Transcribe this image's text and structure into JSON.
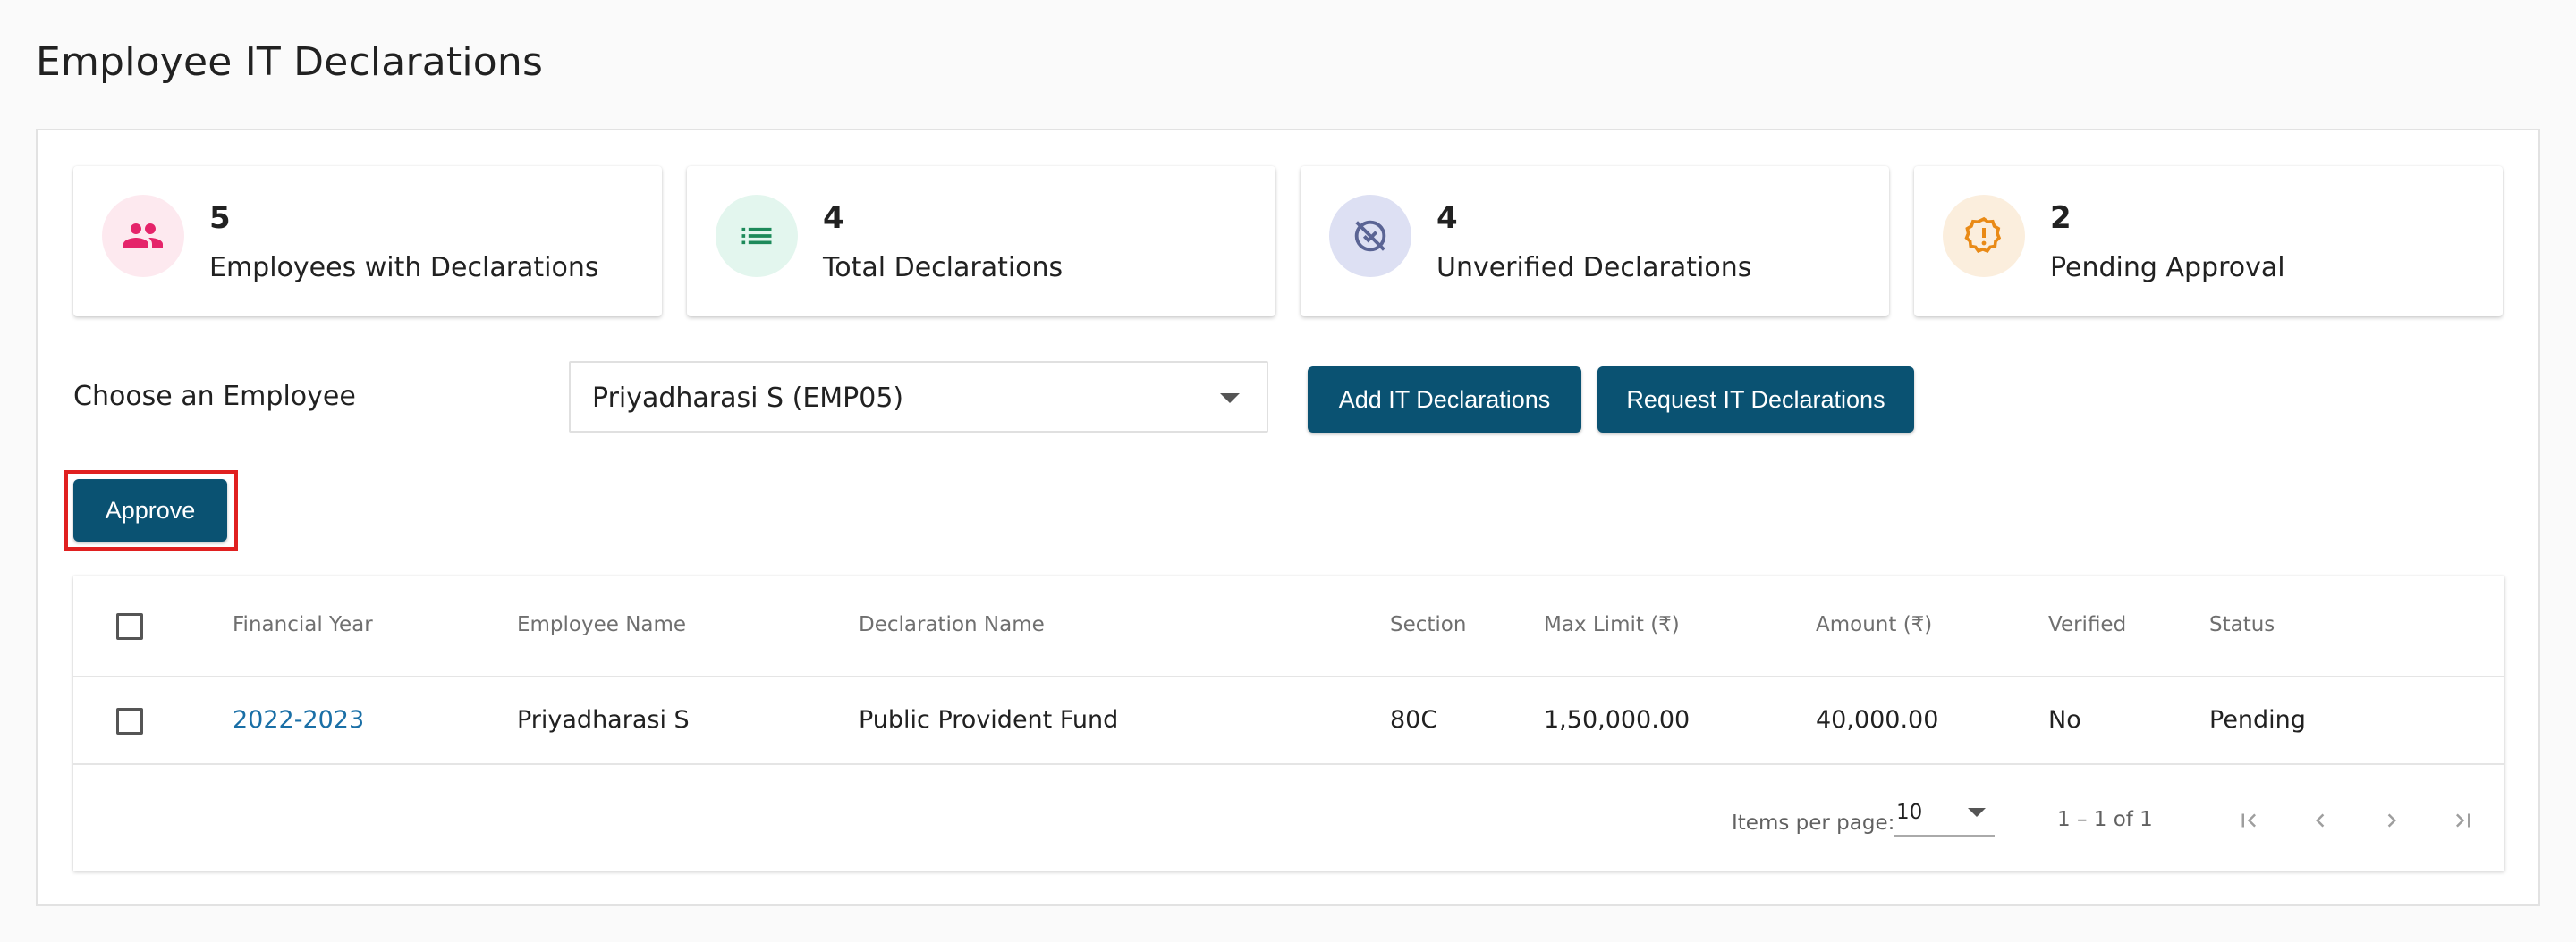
{
  "page": {
    "title": "Employee IT Declarations"
  },
  "colors": {
    "primary": "#0a5272",
    "link": "#1a6fa6",
    "highlight": "#e02020"
  },
  "stats": [
    {
      "count": "5",
      "label": "Employees with Declarations",
      "icon": "people-icon",
      "icon_color": "#e5246a",
      "bg": "#fde9ef"
    },
    {
      "count": "4",
      "label": "Total Declarations",
      "icon": "list-icon",
      "icon_color": "#1d8a5a",
      "bg": "#e3f6ee"
    },
    {
      "count": "4",
      "label": "Unverified Declarations",
      "icon": "unverified-icon",
      "icon_color": "#5a6494",
      "bg": "#dde0f3"
    },
    {
      "count": "2",
      "label": "Pending Approval",
      "icon": "pending-badge-icon",
      "icon_color": "#e98a16",
      "bg": "#fbeedd"
    }
  ],
  "filter": {
    "label": "Choose an Employee",
    "selected": "Priyadharasi S (EMP05)"
  },
  "buttons": {
    "add": "Add IT Declarations",
    "request": "Request IT Declarations",
    "approve": "Approve"
  },
  "table": {
    "columns": [
      "Financial Year",
      "Employee Name",
      "Declaration Name",
      "Section",
      "Max Limit (₹)",
      "Amount (₹)",
      "Verified",
      "Status"
    ],
    "rows": [
      [
        "2022-2023",
        "Priyadharasi S",
        "Public Provident Fund",
        "80C",
        "1,50,000.00",
        "40,000.00",
        "No",
        "Pending"
      ]
    ]
  },
  "pagination": {
    "items_per_page_label": "Items per page:",
    "items_per_page": "10",
    "range": "1 – 1 of 1"
  }
}
